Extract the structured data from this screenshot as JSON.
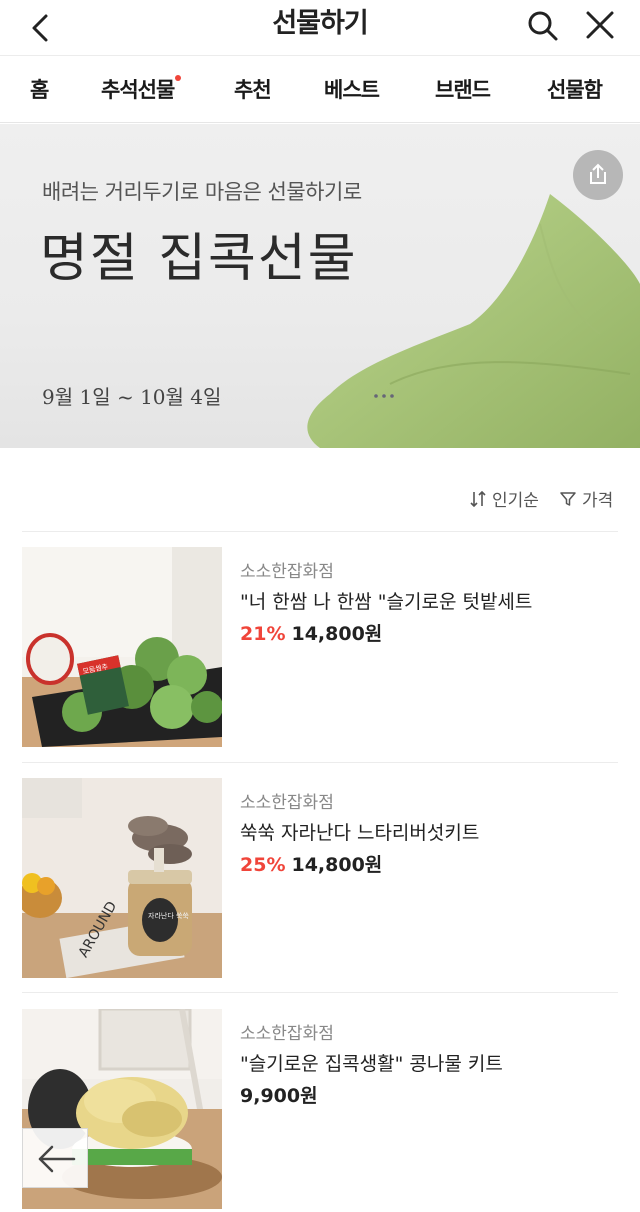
{
  "header": {
    "title": "선물하기",
    "back_icon": "back-arrow-icon",
    "search_icon": "search-icon",
    "close_icon": "close-icon"
  },
  "tabs": [
    {
      "label": "홈"
    },
    {
      "label": "추석선물",
      "has_dot": true
    },
    {
      "label": "추천"
    },
    {
      "label": "베스트"
    },
    {
      "label": "브랜드"
    },
    {
      "label": "선물함"
    }
  ],
  "banner": {
    "subtitle": "배려는 거리두기로 마음은 선물하기로",
    "headline": "명절 집콕선물",
    "dates": "9월 1일 ~ 10월 4일",
    "share_icon": "share-icon"
  },
  "sort": {
    "popular_label": "인기순",
    "price_label": "가격"
  },
  "products": [
    {
      "shop": "소소한잡화점",
      "name": "\"너 한쌈 나 한쌈 \"슬기로운 텃밭세트",
      "discount": "21%",
      "price": "14,800원"
    },
    {
      "shop": "소소한잡화점",
      "name": "쑥쑥 자라난다 느타리버섯키트",
      "discount": "25%",
      "price": "14,800원"
    },
    {
      "shop": "소소한잡화점",
      "name": "\"슬기로운 집콕생활\" 콩나물 키트",
      "discount": "",
      "price": "9,900원"
    }
  ],
  "product_images": {
    "p1": {
      "label": "모듬쌈추"
    },
    "p2": {
      "label1": "AROUND",
      "label2": "자라난다 쑥쑥"
    }
  },
  "colors": {
    "accent_red": "#f0453a",
    "pillow_green": "#a9c47a"
  }
}
